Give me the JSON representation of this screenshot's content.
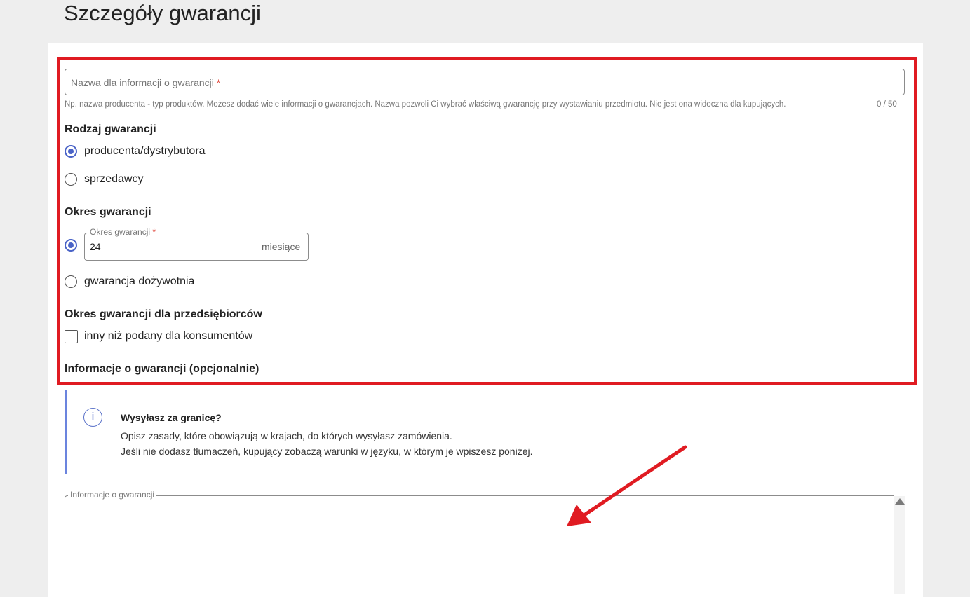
{
  "page": {
    "title": "Szczegóły gwarancji"
  },
  "name_field": {
    "placeholder": "Nazwa dla informacji o gwarancji",
    "required_mark": "*",
    "helper": "Np. nazwa producenta - typ produktów. Możesz dodać wiele informacji o gwarancjach. Nazwa pozwoli Ci wybrać właściwą gwarancję przy wystawianiu przedmiotu. Nie jest ona widoczna dla kupujących.",
    "counter": "0  /  50"
  },
  "warranty_type": {
    "heading": "Rodzaj gwarancji",
    "options": [
      {
        "label": "producenta/dystrybutora",
        "selected": true
      },
      {
        "label": "sprzedawcy",
        "selected": false
      }
    ]
  },
  "warranty_period": {
    "heading": "Okres gwarancji",
    "field_label": "Okres gwarancji",
    "required_mark": "*",
    "value": "24",
    "unit": "miesiące",
    "lifetime_label": "gwarancja dożywotnia",
    "period_selected": true,
    "lifetime_selected": false
  },
  "business_period": {
    "heading": "Okres gwarancji dla przedsiębiorców",
    "checkbox_label": "inny niż podany dla konsumentów",
    "checked": false
  },
  "info_section": {
    "heading": "Informacje o gwarancji (opcjonalnie)",
    "notice_icon": "info-icon",
    "notice_title": "Wysyłasz za granicę?",
    "notice_line1": "Opisz zasady, które obowiązują w krajach, do których wysyłasz zamówienia.",
    "notice_line2": "Jeśli nie dodasz tłumaczeń, kupujący zobaczą warunki w języku, w którym je wpiszesz poniżej.",
    "textarea_label": "Informacje o gwarancji",
    "textarea_value": ""
  },
  "colors": {
    "accent": "#4a63c7",
    "highlight_red": "#e01b22",
    "notice_border": "#6b84de",
    "required": "#e0453a"
  }
}
